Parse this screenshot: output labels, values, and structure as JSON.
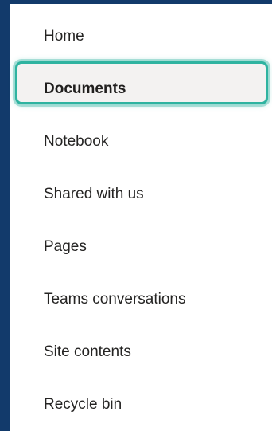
{
  "nav": {
    "items": [
      {
        "label": "Home",
        "selected": false
      },
      {
        "label": "Documents",
        "selected": true
      },
      {
        "label": "Notebook",
        "selected": false
      },
      {
        "label": "Shared with us",
        "selected": false
      },
      {
        "label": "Pages",
        "selected": false
      },
      {
        "label": "Teams conversations",
        "selected": false
      },
      {
        "label": "Site contents",
        "selected": false
      },
      {
        "label": "Recycle bin",
        "selected": false
      }
    ]
  },
  "colors": {
    "frame": "#123a6b",
    "highlight_border": "#2eb3a0",
    "selected_bg": "#f3f2f1",
    "text": "#252423"
  }
}
